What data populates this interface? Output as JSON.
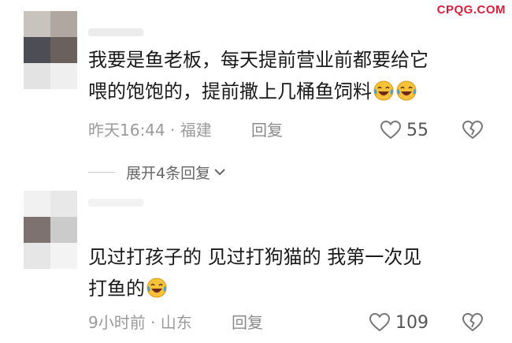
{
  "watermark": "CPQG.COM",
  "comments": [
    {
      "text_line1": "我要是鱼老板，每天提前营业前都要给它",
      "text_line2": "喂的饱饱的，提前撒上几桶鱼饲料",
      "meta": "昨天16:44 · 福建",
      "reply_label": "回复",
      "likes": "55",
      "expand_label": "展开4条回复",
      "icons": [
        "laughing-crying-emoji-icon",
        "heart-outline-icon",
        "broken-heart-icon",
        "chevron-down-icon"
      ]
    },
    {
      "text_line1": "见过打孩子的 见过打狗猫的 我第一次见",
      "text_line2": "打鱼的",
      "meta": "9小时前 · 山东",
      "reply_label": "回复",
      "likes": "109",
      "icons": [
        "laughing-crying-emoji-icon",
        "heart-outline-icon",
        "broken-heart-icon"
      ]
    }
  ],
  "colors": {
    "watermark": "#d81e3a",
    "text": "#1a1a1a",
    "meta": "#9a9a9a",
    "emoji_face": "#f7c23a",
    "emoji_tears": "#3aa0e8"
  }
}
